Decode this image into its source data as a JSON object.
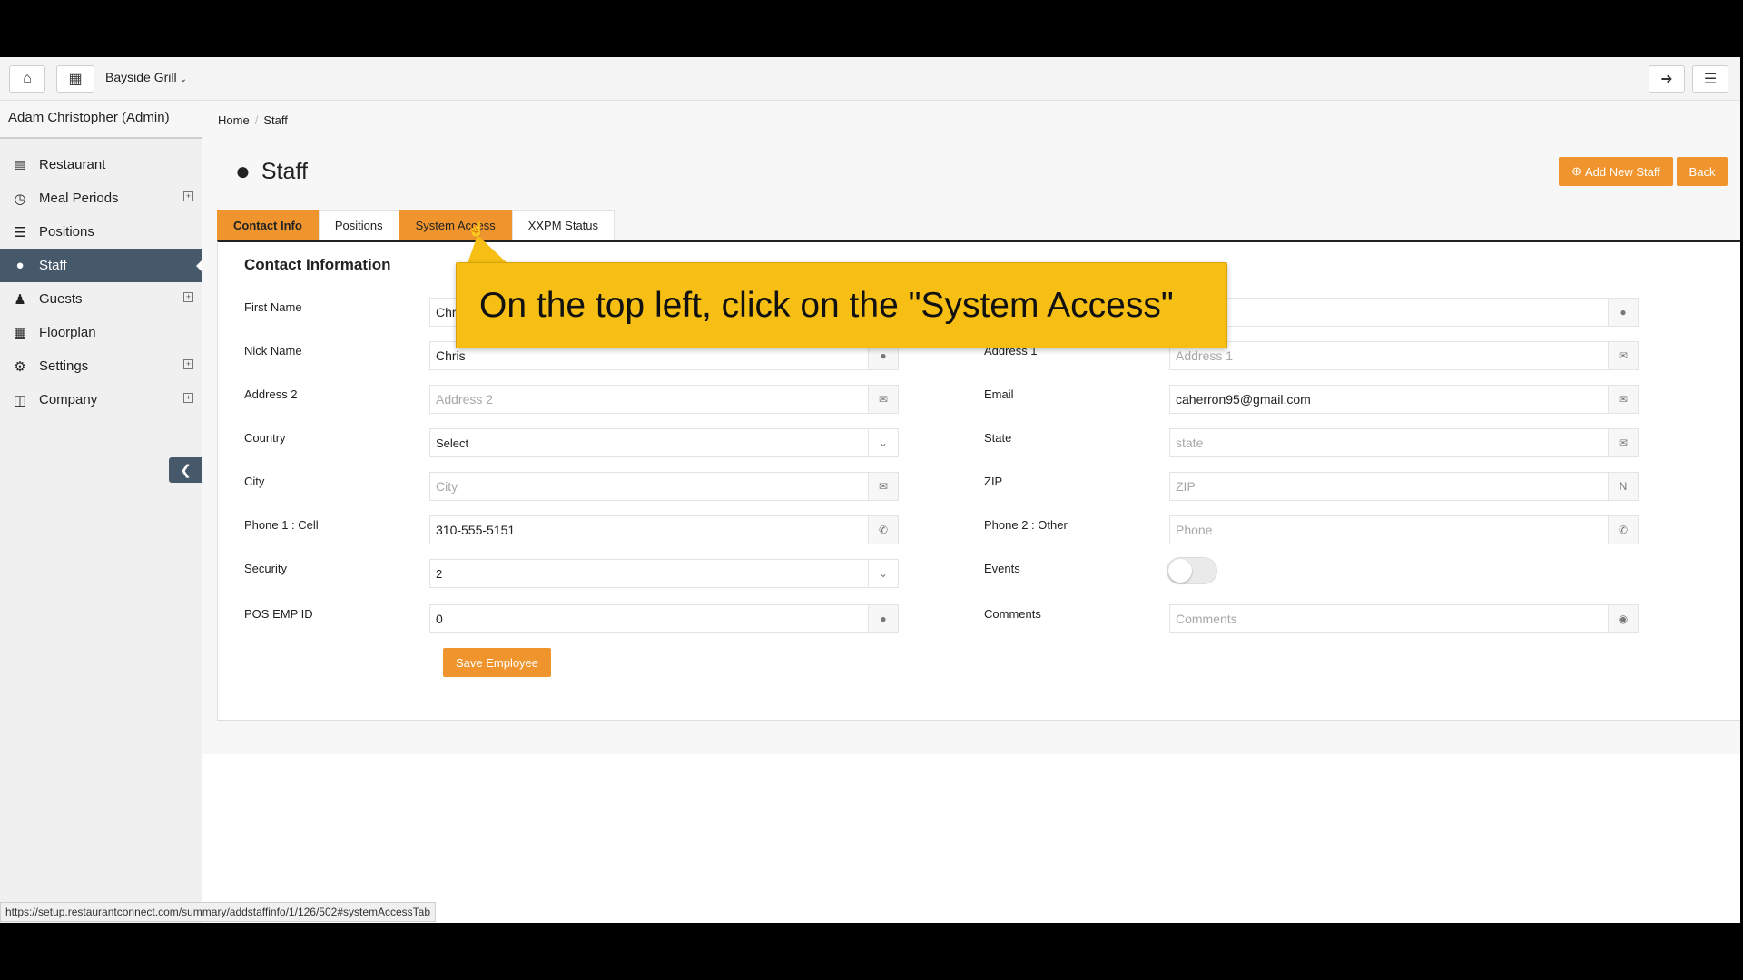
{
  "topbar": {
    "home_icon": "home-icon",
    "building_icon": "building-icon",
    "venue": "Bayside Grill",
    "logout_icon": "sign-out-icon",
    "menu_icon": "hamburger-icon"
  },
  "sidebar": {
    "user": "Adam Christopher (Admin)",
    "items": [
      {
        "label": "Restaurant",
        "icon": "list-alt-icon"
      },
      {
        "label": "Meal Periods",
        "icon": "clock-icon",
        "expand": "⊞"
      },
      {
        "label": "Positions",
        "icon": "list-icon"
      },
      {
        "label": "Staff",
        "icon": "user-icon"
      },
      {
        "label": "Guests",
        "icon": "users-icon",
        "expand": "⊞"
      },
      {
        "label": "Floorplan",
        "icon": "th-large-icon"
      },
      {
        "label": "Settings",
        "icon": "gear-icon",
        "expand": "⊞"
      },
      {
        "label": "Company",
        "icon": "building-icon",
        "expand": "⊞"
      }
    ]
  },
  "breadcrumb": {
    "home": "Home",
    "sep": "/",
    "current": "Staff"
  },
  "page": {
    "title": "Staff",
    "add_button": "Add New Staff",
    "back_button": "Back"
  },
  "tabs": [
    "Contact Info",
    "Positions",
    "System Access",
    "XXPM Status"
  ],
  "form": {
    "title": "Contact Information",
    "left": [
      {
        "label": "First Name",
        "value": "Chris",
        "icon": "user-icon"
      },
      {
        "label": "Nick Name",
        "value": "Chris",
        "icon": "user-icon"
      },
      {
        "label": "Address 2",
        "placeholder": "Address 2",
        "icon": "envelope-icon"
      },
      {
        "label": "Country",
        "value": "Select",
        "icon": "chevron-down-icon"
      },
      {
        "label": "City",
        "placeholder": "City",
        "icon": "envelope-icon"
      },
      {
        "label": "Phone 1 : Cell",
        "value": "310-555-5151",
        "icon": "phone-icon"
      },
      {
        "label": "Security",
        "value": "2",
        "icon": "chevron-down-icon"
      },
      {
        "label": "POS EMP ID",
        "value": "0",
        "icon": "user-icon"
      }
    ],
    "right": [
      {
        "label": "",
        "value": "",
        "icon": "user-icon"
      },
      {
        "label": "Address 1",
        "placeholder": "Address 1",
        "icon": "envelope-icon"
      },
      {
        "label": "Email",
        "value": "caherron95@gmail.com",
        "icon": "envelope-icon"
      },
      {
        "label": "State",
        "placeholder": "state",
        "icon": "envelope-icon"
      },
      {
        "label": "ZIP",
        "placeholder": "ZIP",
        "icon": "N"
      },
      {
        "label": "Phone 2 : Other",
        "placeholder": "Phone",
        "icon": "phone-icon"
      },
      {
        "label": "Events",
        "toggle": false
      },
      {
        "label": "Comments",
        "placeholder": "Comments",
        "icon": "comment-icon"
      }
    ],
    "save_button": "Save Employee"
  },
  "callout": "On the top left, click on the \"System Access\"",
  "status_url": "https://setup.restaurantconnect.com/summary/addstaffinfo/1/126/502#systemAccessTab",
  "colors": {
    "accent": "#f0952e",
    "sidebar_active": "#46596b",
    "callout": "#f7bf14"
  }
}
